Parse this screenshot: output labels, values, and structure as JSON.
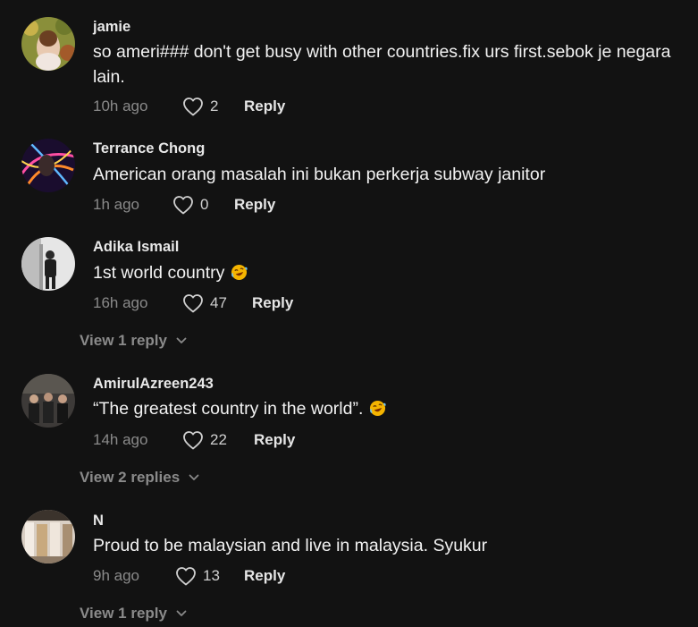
{
  "comments": [
    {
      "username": "jamie",
      "text": "so ameri### don't get busy with other countries.fix urs first.sebok je negara lain.",
      "time": "10h ago",
      "likes": "2",
      "reply_label": "Reply"
    },
    {
      "username": "Terrance Chong",
      "text": "American orang masalah ini bukan perkerja subway janitor",
      "time": "1h ago",
      "likes": "0",
      "reply_label": "Reply"
    },
    {
      "username": "Adika Ismail",
      "text": "1st world country",
      "time": "16h ago",
      "likes": "47",
      "reply_label": "Reply",
      "view_replies": "View 1 reply"
    },
    {
      "username": "AmirulAzreen243",
      "text": "“The greatest country in the world”.",
      "time": "14h ago",
      "likes": "22",
      "reply_label": "Reply",
      "view_replies": "View 2 replies"
    },
    {
      "username": "N",
      "text": "Proud to be malaysian and live in malaysia. Syukur",
      "time": "9h ago",
      "likes": "13",
      "reply_label": "Reply",
      "view_replies": "View 1 reply"
    }
  ],
  "icons": {
    "like": "heart-outline-icon",
    "expand": "chevron-down-icon",
    "emoji": "rolling-on-floor-laughing-emoji"
  }
}
